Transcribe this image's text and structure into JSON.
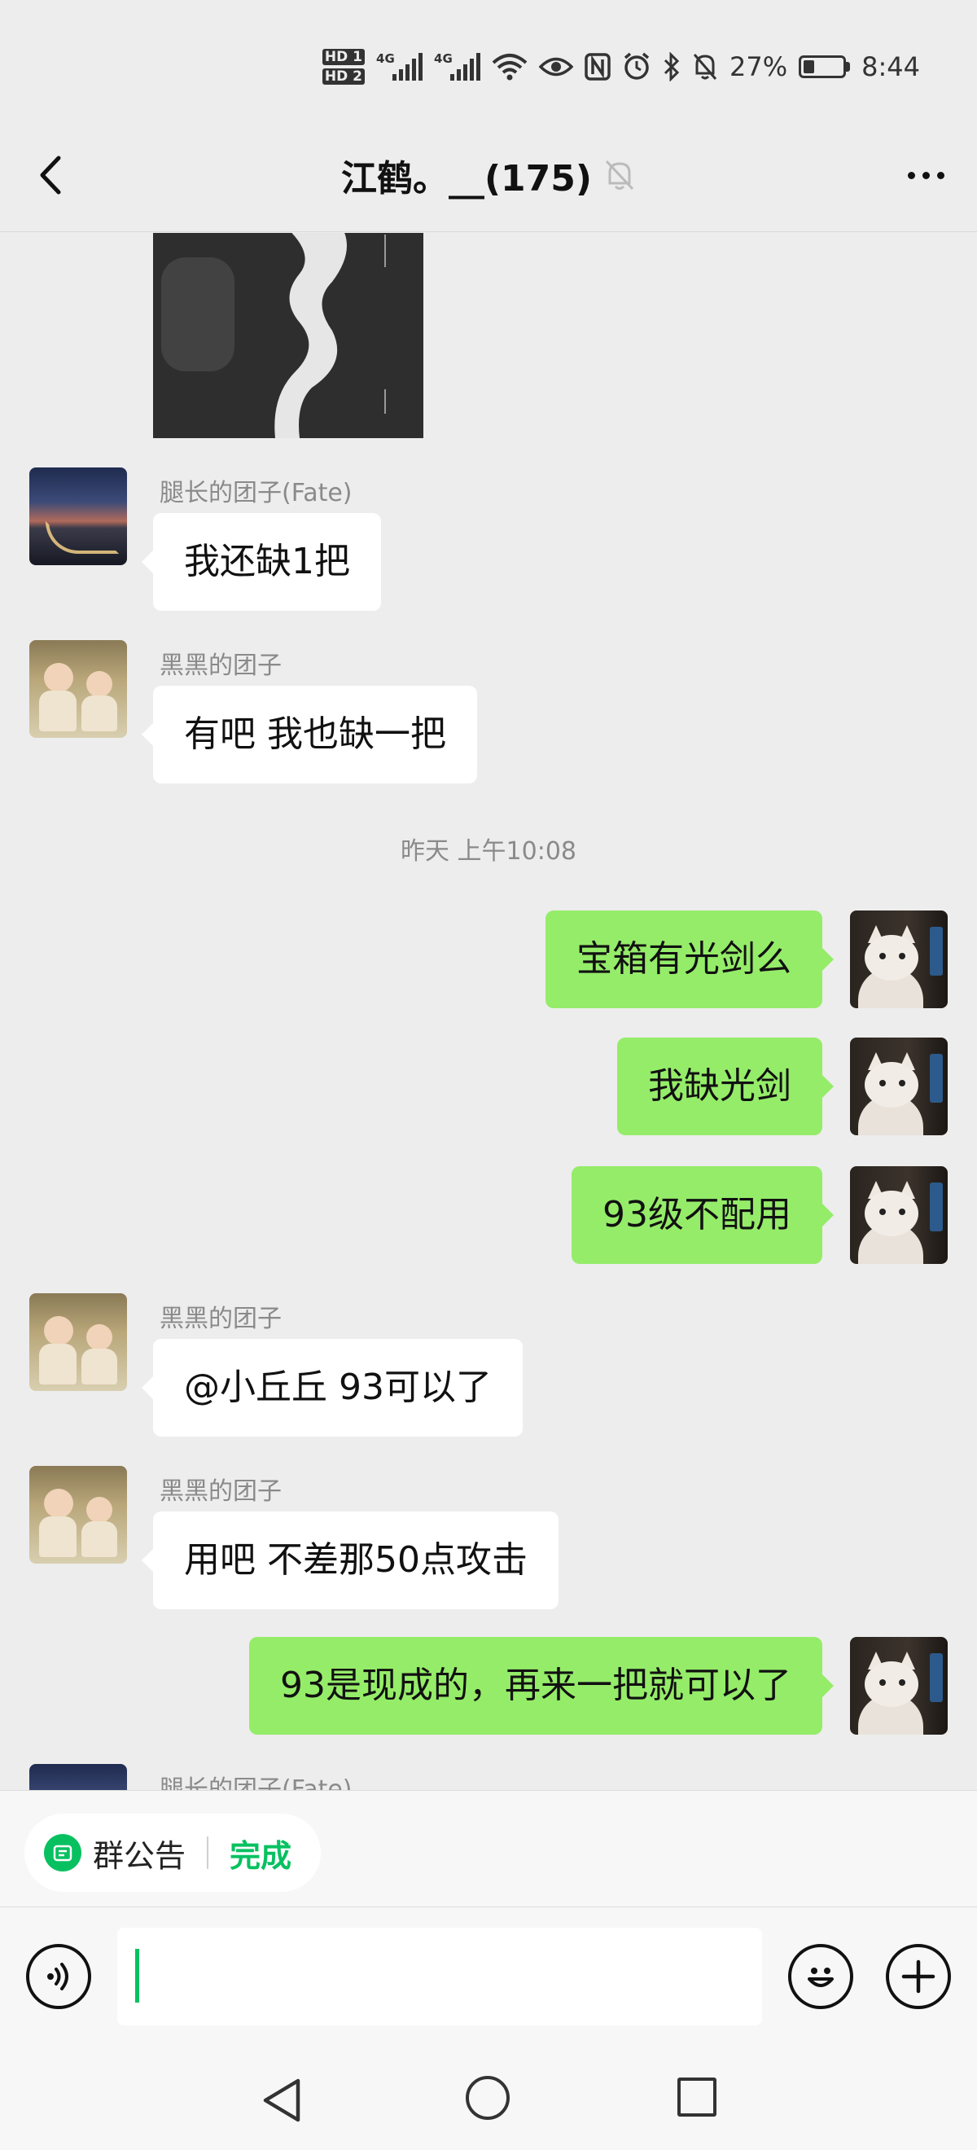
{
  "status_bar": {
    "hd1": "HD 1",
    "hd2": "HD 2",
    "net1": "4G",
    "net2": "4G",
    "battery": "27%",
    "battery_level": 0.27,
    "time": "8:44",
    "icons": [
      "eye-icon",
      "nfc-icon",
      "alarm-icon",
      "bluetooth-icon",
      "mute-icon",
      "wifi-icon"
    ]
  },
  "header": {
    "title": "江鹤。__(175)",
    "back_icon": "chevron-left-icon",
    "mute_icon": "bell-muted-icon",
    "more_icon": "more-dots-icon"
  },
  "messages": [
    {
      "type": "image",
      "side": "in"
    },
    {
      "type": "text",
      "side": "in",
      "sender": "腿长的团子(Fate)",
      "avatar": "landscape",
      "text": "我还缺1把"
    },
    {
      "type": "text",
      "side": "in",
      "sender": "黑黑的团子",
      "avatar": "babies",
      "text": "有吧 我也缺一把"
    },
    {
      "type": "time",
      "text": "昨天 上午10:08"
    },
    {
      "type": "text",
      "side": "out",
      "avatar": "cat",
      "text": "宝箱有光剑么"
    },
    {
      "type": "text",
      "side": "out",
      "avatar": "cat",
      "text": "我缺光剑"
    },
    {
      "type": "text",
      "side": "out",
      "avatar": "cat",
      "text": "93级不配用"
    },
    {
      "type": "text",
      "side": "in",
      "sender": "黑黑的团子",
      "avatar": "babies",
      "text": "@小丘丘 93可以了"
    },
    {
      "type": "text",
      "side": "in",
      "sender": "黑黑的团子",
      "avatar": "babies",
      "text": "用吧 不差那50点攻击"
    },
    {
      "type": "text",
      "side": "out",
      "avatar": "cat",
      "text": "93是现成的，再来一把就可以了"
    },
    {
      "type": "partial",
      "side": "in",
      "sender": "腿长的团子(Fate)",
      "avatar": "landscape"
    }
  ],
  "bottom": {
    "notice_label": "群公告",
    "notice_done": "完成",
    "input_value": "",
    "colors": {
      "accent": "#07c160",
      "bubble_out": "#95ec69",
      "bubble_in": "#ffffff"
    }
  }
}
